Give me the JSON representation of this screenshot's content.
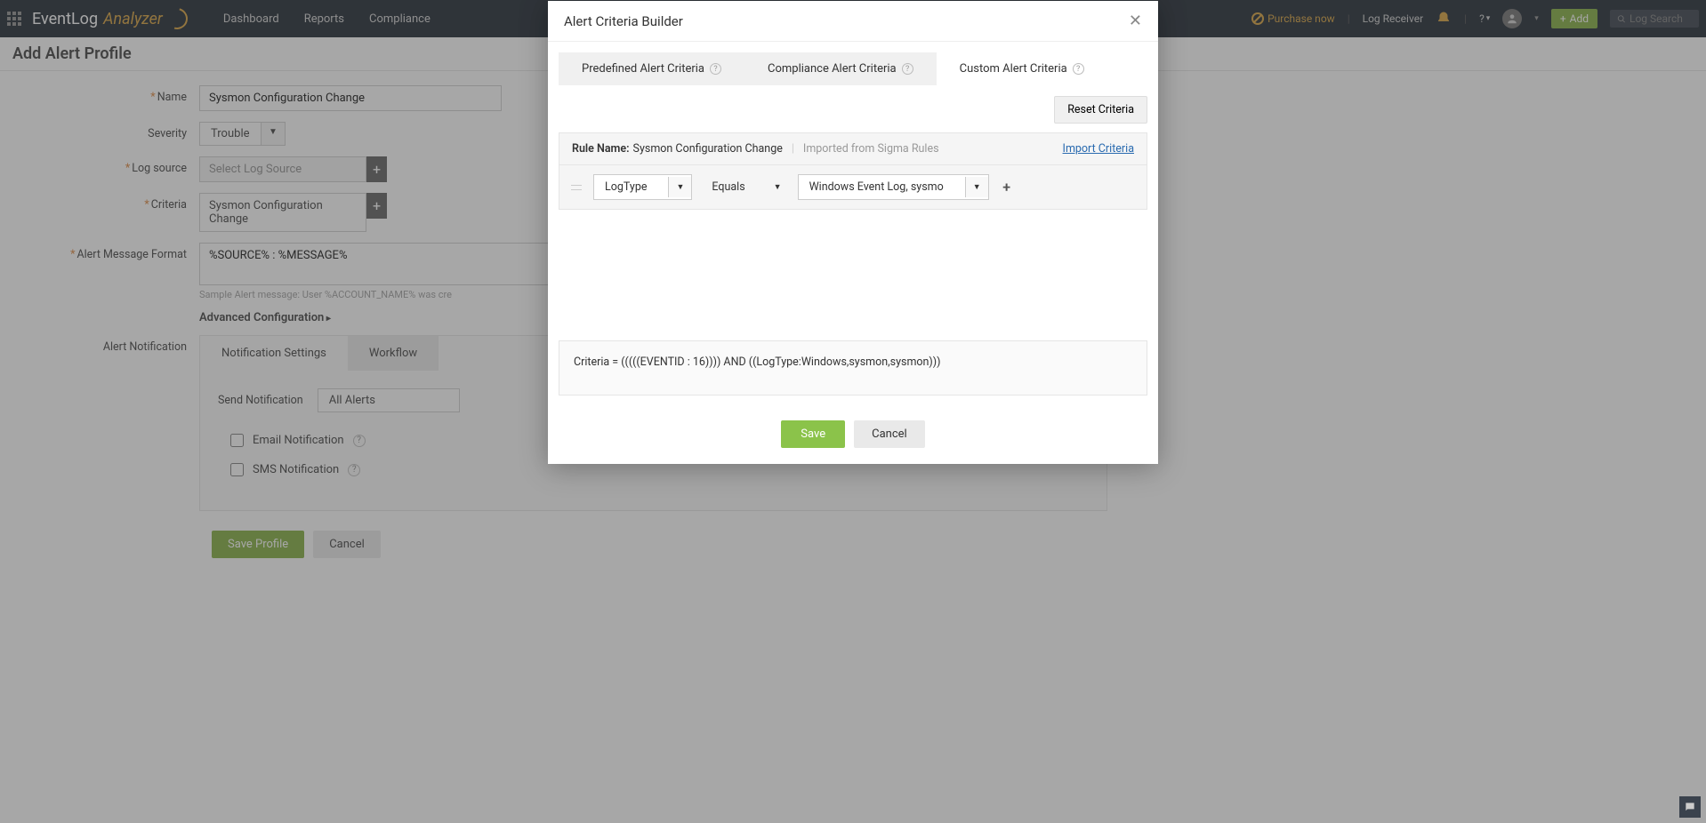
{
  "header": {
    "logo_part1": "EventLog",
    "logo_part2": "Analyzer",
    "nav": [
      "Dashboard",
      "Reports",
      "Compliance"
    ],
    "purchase": "Purchase now",
    "log_receiver": "Log Receiver",
    "add": "Add",
    "search_placeholder": "Log Search"
  },
  "page": {
    "title": "Add Alert Profile",
    "fields": {
      "name_label": "Name",
      "name_value": "Sysmon Configuration Change",
      "severity_label": "Severity",
      "severity_value": "Trouble",
      "log_source_label": "Log source",
      "log_source_placeholder": "Select Log Source",
      "criteria_label": "Criteria",
      "criteria_value": "Sysmon Configuration Change",
      "msg_format_label": "Alert Message Format",
      "msg_format_value": "%SOURCE% : %MESSAGE%",
      "sample_msg": "Sample Alert message: User %ACCOUNT_NAME% was cre",
      "adv_config": "Advanced Configuration"
    },
    "notification": {
      "label": "Alert Notification",
      "tabs": [
        "Notification Settings",
        "Workflow"
      ],
      "send_label": "Send Notification",
      "send_value": "All Alerts",
      "email_label": "Email Notification",
      "sms_label": "SMS Notification"
    },
    "buttons": {
      "save": "Save Profile",
      "cancel": "Cancel"
    }
  },
  "modal": {
    "title": "Alert Criteria Builder",
    "tabs": [
      "Predefined Alert Criteria",
      "Compliance Alert Criteria",
      "Custom Alert Criteria"
    ],
    "reset": "Reset Criteria",
    "rule_name_label": "Rule Name:",
    "rule_name_value": "Sysmon Configuration Change",
    "imported": "Imported from Sigma Rules",
    "import_link": "Import Criteria",
    "criteria": {
      "field": "LogType",
      "operator": "Equals",
      "value": "Windows Event Log, sysmo"
    },
    "criteria_text": "Criteria = (((((EVENTID : 16)))) AND ((LogType:Windows,sysmon,sysmon)))",
    "buttons": {
      "save": "Save",
      "cancel": "Cancel"
    }
  }
}
